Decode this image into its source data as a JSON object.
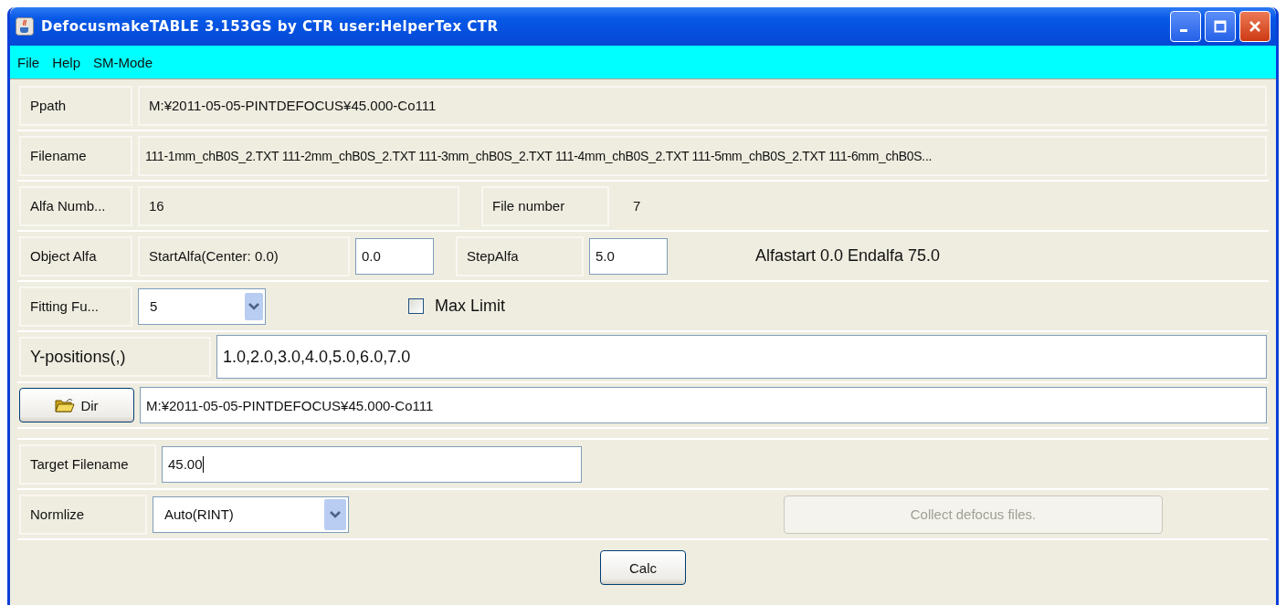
{
  "window": {
    "title": "DefocusmakeTABLE 3.153GS by CTR  user:HelperTex CTR"
  },
  "menu": [
    {
      "label": "File"
    },
    {
      "label": "Help"
    },
    {
      "label": "SM-Mode"
    }
  ],
  "ppath": {
    "label": "Ppath",
    "value": "M:¥2011-05-05-PINTDEFOCUS¥45.000-Co111"
  },
  "filename": {
    "label": "Filename",
    "value": "111-1mm_chB0S_2.TXT 111-2mm_chB0S_2.TXT 111-3mm_chB0S_2.TXT 111-4mm_chB0S_2.TXT 111-5mm_chB0S_2.TXT 111-6mm_chB0S..."
  },
  "alfa_number": {
    "label": "Alfa Numb...",
    "value": "16"
  },
  "file_number": {
    "label": "File number",
    "value": "7"
  },
  "object_alfa": {
    "label": "Object Alfa",
    "start_label": "StartAlfa(Center: 0.0)",
    "start_value": "0.0",
    "step_label": "StepAlfa",
    "step_value": "5.0",
    "summary": "Alfastart 0.0 Endalfa 75.0"
  },
  "fitting": {
    "label": "Fitting Fu...",
    "value": "5"
  },
  "max_limit": {
    "label": "Max Limit",
    "checked": false
  },
  "y_positions": {
    "label": "Y-positions(,)",
    "value": "1.0,2.0,3.0,4.0,5.0,6.0,7.0"
  },
  "dir": {
    "button": "Dir",
    "value": "M:¥2011-05-05-PINTDEFOCUS¥45.000-Co111"
  },
  "target_filename": {
    "label": "Target Filename",
    "value": "45.00"
  },
  "normalize": {
    "label": "Normlize",
    "value": "Auto(RINT)"
  },
  "collect_button": {
    "label": "Collect defocus files.",
    "disabled": true
  },
  "calc_button": {
    "label": "Calc",
    "disabled": false
  }
}
